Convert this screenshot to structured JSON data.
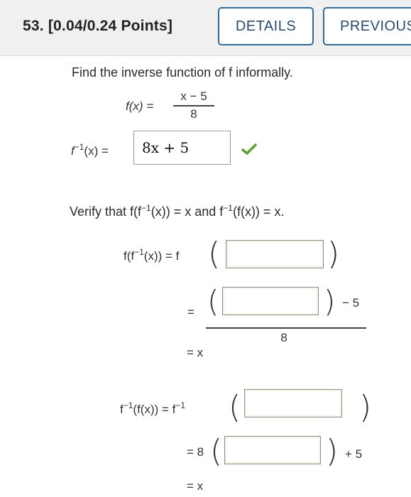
{
  "header": {
    "question_number": "53.",
    "points": "[0.04/0.24 Points]",
    "details_label": "DETAILS",
    "previous_label": "PREVIOUS"
  },
  "problem": {
    "instruction": "Find the inverse function of f informally.",
    "fx_lhs": "f(x) =",
    "fx_numerator": "x − 5",
    "fx_denominator": "8",
    "finv_lhs_f": "f",
    "finv_lhs_exp": "−1",
    "finv_lhs_rest": "(x) =",
    "finv_answer": "8x + 5",
    "answer_status": "correct"
  },
  "verify": {
    "instruction_pre": "Verify that f(f",
    "instruction_exp1": "−1",
    "instruction_mid": "(x)) = x and f",
    "instruction_exp2": "−1",
    "instruction_end": "(f(x)) = x.",
    "part1": {
      "lhs_pre": "f(f",
      "lhs_exp": "−1",
      "lhs_post": "(x)) = f",
      "box1_value": "",
      "eq_sign": "=",
      "box2_value": "",
      "num_suffix": "− 5",
      "denominator": "8",
      "result": "= x"
    },
    "part2": {
      "lhs_pre": "f",
      "lhs_exp": "−1",
      "lhs_post": "(f(x)) = f",
      "rhs_exp": "−1",
      "box3_value": "",
      "eq_prefix": "= 8",
      "box4_value": "",
      "suffix": "+ 5",
      "result": "= x"
    }
  }
}
